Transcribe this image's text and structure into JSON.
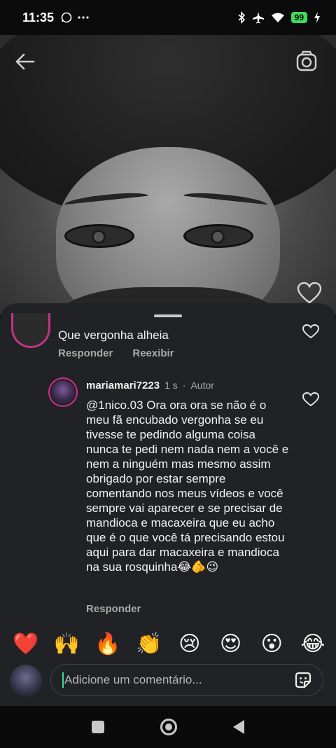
{
  "status_bar": {
    "time": "11:35",
    "left_icons": [
      "whatsapp-icon",
      "more-dots-icon"
    ],
    "battery": "99",
    "right_icons": [
      "bluetooth-icon",
      "airplane-icon",
      "wifi-icon",
      "battery-icon",
      "charging-icon"
    ]
  },
  "top_bar": {
    "back_icon": "back-arrow-icon",
    "camera_icon": "camera-icon"
  },
  "comments": [
    {
      "text": "Que vergonha alheia",
      "actions": [
        "Responder",
        "Reexibir"
      ]
    },
    {
      "username": "mariamari7223",
      "time": "1 s",
      "separator": "·",
      "author_label": "Autor",
      "text": "@1nico.03 Ora ora ora se não é o meu fã encubado vergonha se eu tivesse te pedindo alguma coisa nunca te pedi nem nada nem a você e nem a ninguém mas mesmo assim obrigado por estar sempre comentando nos meus vídeos e você sempre vai aparecer e se precisar de mandioca e macaxeira que eu acho que é o que você tá precisando estou aqui para dar macaxeira e mandioca na sua rosquinha😂🫵😉",
      "reply_label": "Responder"
    }
  ],
  "emoji_bar": [
    "❤️",
    "🙌",
    "🔥",
    "👏",
    "😢",
    "😍",
    "😮",
    "😂"
  ],
  "comment_input": {
    "placeholder": "Adicione um comentário..."
  },
  "colors": {
    "sheet_bg": "#212225",
    "muted_text": "#a8a8a8",
    "story_ring": "#d12f8b",
    "caret": "#3ddc97"
  }
}
